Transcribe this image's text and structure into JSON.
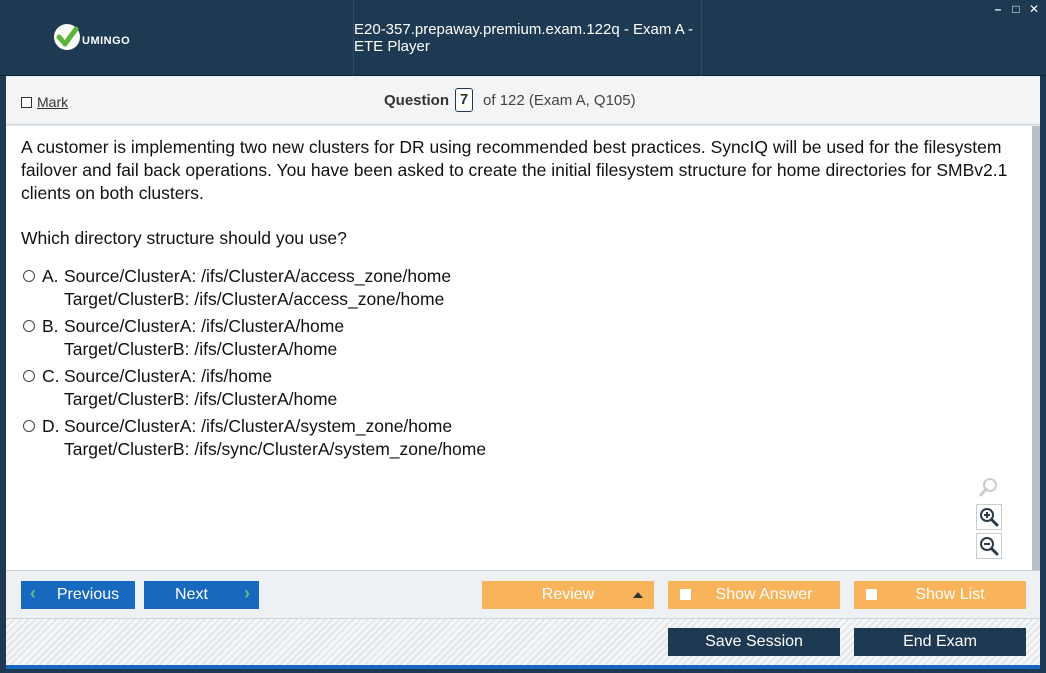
{
  "app": {
    "logo_text": "UMINGO",
    "title": "E20-357.prepaway.premium.exam.122q - Exam A - ETE Player",
    "window_controls": {
      "minimize": "–",
      "maximize": "□",
      "close": "✕"
    }
  },
  "question_bar": {
    "mark_label": "Mark",
    "question_label": "Question",
    "question_number": "7",
    "of_text": "of 122 (Exam A, Q105)"
  },
  "question": {
    "text": "A customer is implementing two new clusters for DR using recommended best practices. SyncIQ will be used for the filesystem failover and fail back operations. You have been asked to create the initial filesystem structure for home directories for SMBv2.1 clients on both clusters.",
    "ask": "Which directory structure should you use?",
    "options": [
      {
        "letter": "A.",
        "line1": "Source/ClusterA: /ifs/ClusterA/access_zone/home",
        "line2": "Target/ClusterB: /ifs/ClusterA/access_zone/home"
      },
      {
        "letter": "B.",
        "line1": "Source/ClusterA: /ifs/ClusterA/home",
        "line2": "Target/ClusterB: /ifs/ClusterA/home"
      },
      {
        "letter": "C.",
        "line1": "Source/ClusterA: /ifs/home",
        "line2": "Target/ClusterB: /ifs/ClusterA/home"
      },
      {
        "letter": "D.",
        "line1": "Source/ClusterA: /ifs/ClusterA/system_zone/home",
        "line2": "Target/ClusterB: /ifs/sync/ClusterA/system_zone/home"
      }
    ]
  },
  "zoom": {
    "icons": [
      "search-icon",
      "zoom-in-icon",
      "zoom-out-icon"
    ]
  },
  "nav": {
    "previous": "Previous",
    "next": "Next",
    "review": "Review",
    "show_answer": "Show Answer",
    "show_list": "Show List"
  },
  "footer": {
    "save_session": "Save Session",
    "end_exam": "End Exam"
  },
  "colors": {
    "titlebar": "#1d3a52",
    "nav_blue": "#1769c0",
    "orange": "#f9b35a",
    "dark_button": "#1d3a52",
    "logo_green": "#5cb53a"
  }
}
